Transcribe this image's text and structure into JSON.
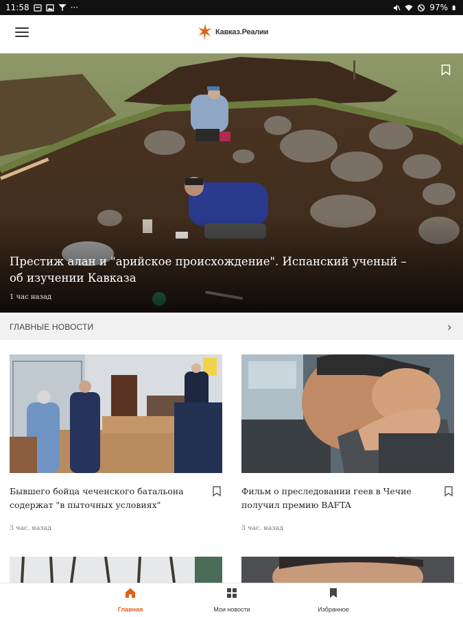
{
  "status_bar": {
    "time": "11:58",
    "dots": "···",
    "battery": "97%"
  },
  "app": {
    "logo_text": "Кавказ.Реалии",
    "accent_color": "#e35f1c"
  },
  "hero": {
    "title": "Престиж алан и \"арийское происхождение\". Испанский ученый – об изучении Кавказа",
    "time": "1 час назад"
  },
  "section": {
    "title": "ГЛАВНЫЕ НОВОСТИ"
  },
  "cards": [
    {
      "title": "Бывшего бойца чеченского батальона содержат \"в пыточных условиях\"",
      "time": "3 час. назад"
    },
    {
      "title": "Фильм о преследовании геев в Чечие получил премию BAFTA",
      "time": "3 час. назад"
    }
  ],
  "bottom_nav": {
    "items": [
      {
        "label": "Главная",
        "icon": "home-icon",
        "active": true
      },
      {
        "label": "Мои новости",
        "icon": "grid-icon",
        "active": false
      },
      {
        "label": "Избранное",
        "icon": "bookmark-icon",
        "active": false
      }
    ]
  }
}
